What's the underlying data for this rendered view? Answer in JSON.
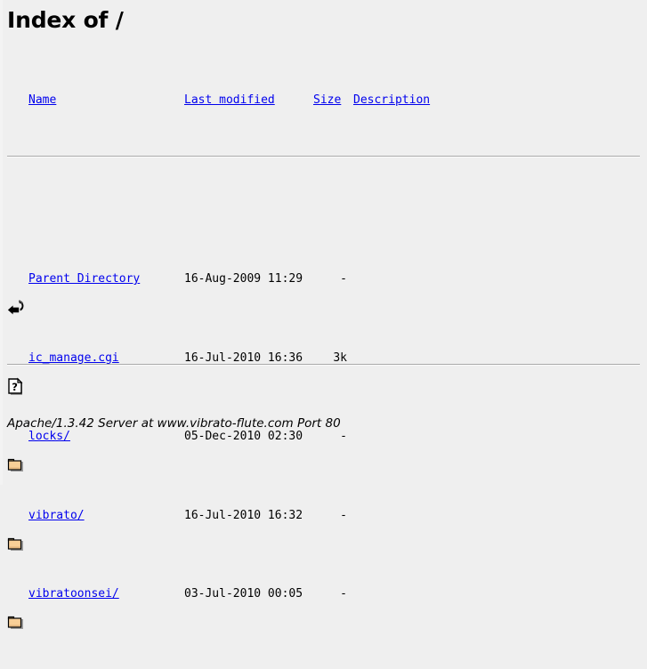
{
  "page": {
    "title": "Index of /",
    "background_color": "#efefef",
    "link_color": "#0000ee",
    "rule_color": "#aaaaaa"
  },
  "columns": {
    "name": "Name",
    "last_modified": "Last modified",
    "size": "Size",
    "description": "Description"
  },
  "entries": [
    {
      "icon": "back-arrow-icon",
      "name": "Parent Directory",
      "last_modified": "16-Aug-2009 11:29",
      "size": "-",
      "description": ""
    },
    {
      "icon": "unknown-file-icon",
      "name": "ic_manage.cgi",
      "last_modified": "16-Jul-2010 16:36",
      "size": "3k",
      "description": ""
    },
    {
      "icon": "folder-icon",
      "name": "locks/",
      "last_modified": "05-Dec-2010 02:30",
      "size": "-",
      "description": ""
    },
    {
      "icon": "folder-icon",
      "name": "vibrato/",
      "last_modified": "16-Jul-2010 16:32",
      "size": "-",
      "description": ""
    },
    {
      "icon": "folder-icon",
      "name": "vibratoonsei/",
      "last_modified": "03-Jul-2010 00:05",
      "size": "-",
      "description": ""
    }
  ],
  "footer": {
    "server_signature": "Apache/1.3.42 Server at www.vibrato-flute.com Port 80"
  }
}
